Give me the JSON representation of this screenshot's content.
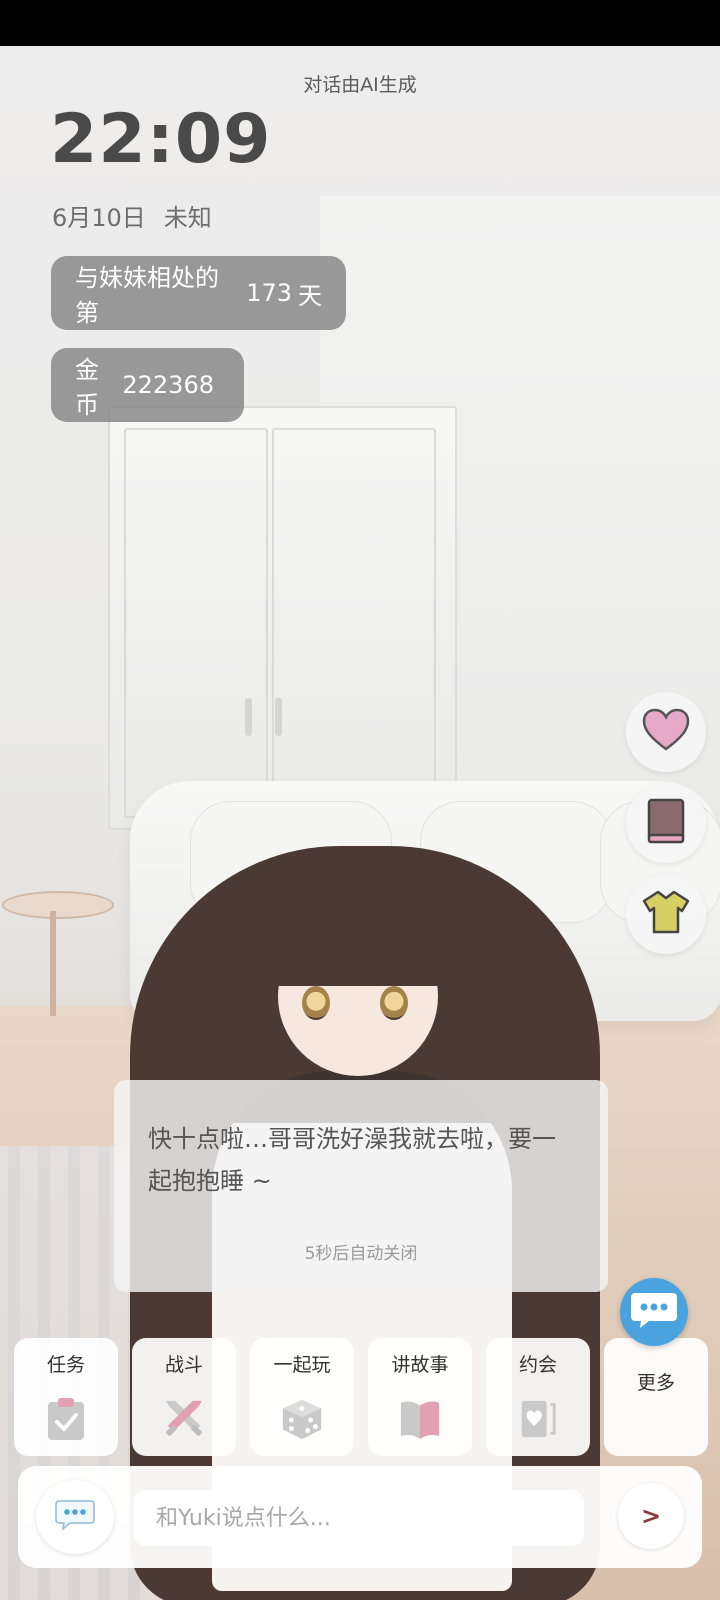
{
  "header": {
    "disclaimer": "对话由AI生成",
    "time": "22:09",
    "date": "6月10日",
    "weather": "未知"
  },
  "stats": {
    "days_prefix": "与妹妹相处的第",
    "days_count": "173",
    "days_suffix": "天",
    "coins_label": "金币",
    "coins_value": "222368"
  },
  "side_buttons": {
    "heart_icon": "heart-icon",
    "book_icon": "book-icon",
    "shirt_icon": "shirt-icon"
  },
  "dialog": {
    "message": "快十点啦…哥哥洗好澡我就去啦，要一起抱抱睡 ~",
    "auto_close": "5秒后自动关闭"
  },
  "actions": [
    {
      "label": "任务",
      "icon": "clipboard-check-icon"
    },
    {
      "label": "战斗",
      "icon": "crossed-swords-icon"
    },
    {
      "label": "一起玩",
      "icon": "dice-icon"
    },
    {
      "label": "讲故事",
      "icon": "open-book-icon"
    },
    {
      "label": "约会",
      "icon": "heart-card-icon"
    },
    {
      "label": "更多",
      "icon": ""
    }
  ],
  "input": {
    "placeholder": "和Yuki说点什么...",
    "send_label": ">"
  },
  "colors": {
    "accent_blue": "#4aa3df",
    "pill_gray": "#808080",
    "heart_pink": "#e6a9c8",
    "book_brown": "#8a6a6e",
    "shirt_yellow": "#d6cf63"
  }
}
